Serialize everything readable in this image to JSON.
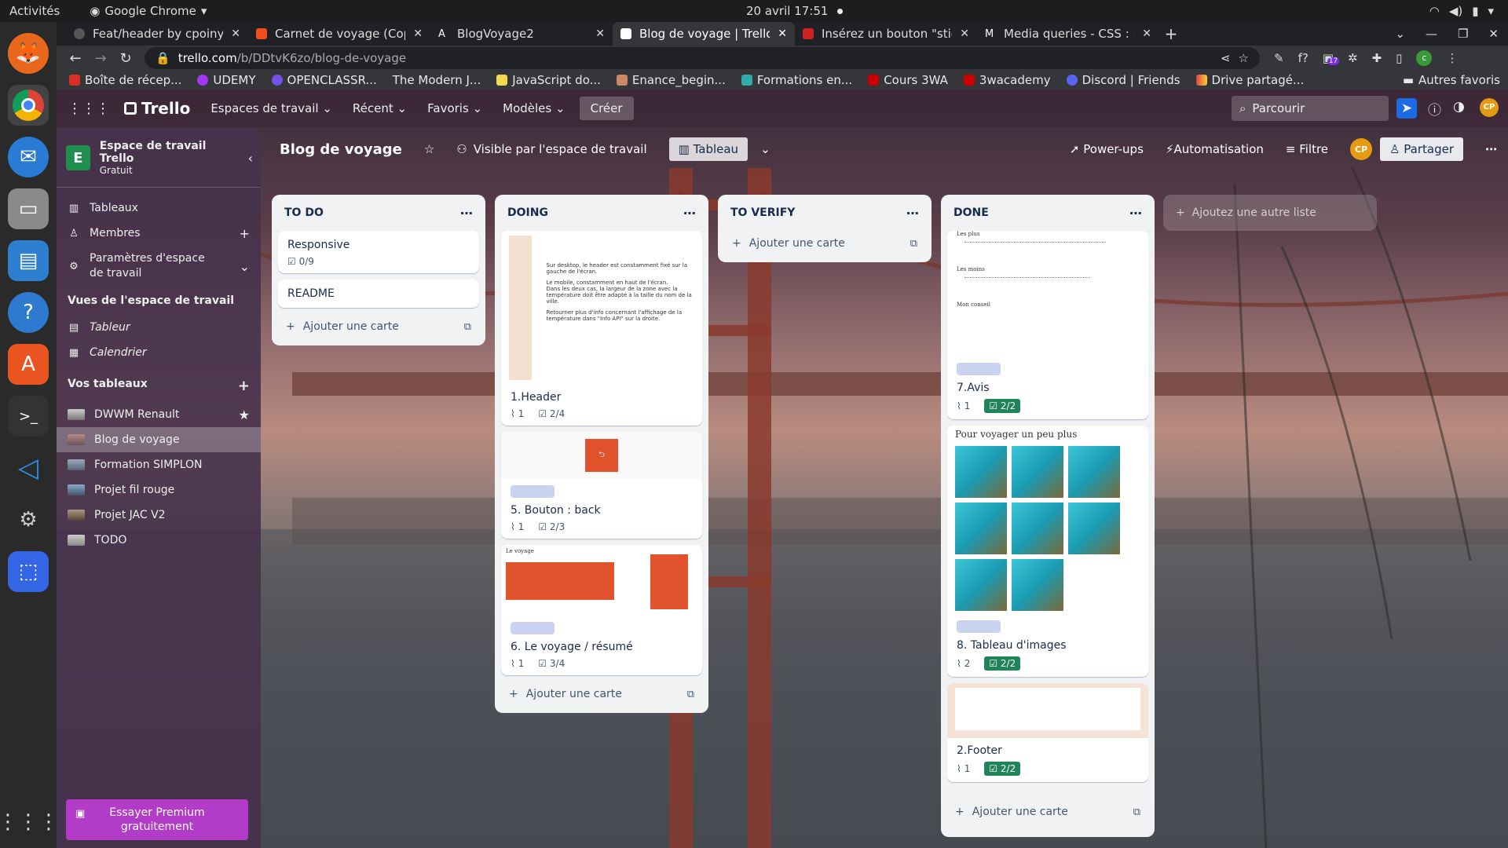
{
  "os": {
    "activities": "Activités",
    "app_name": "Google Chrome",
    "datetime": "20 avril  17:51"
  },
  "browser": {
    "tabs": [
      {
        "title": "Feat/header by cpoiny · P",
        "active": false
      },
      {
        "title": "Carnet de voyage (Copy) –",
        "active": false
      },
      {
        "title": "BlogVoyage2",
        "active": false
      },
      {
        "title": "Blog de voyage | Trello",
        "active": true
      },
      {
        "title": "Insérez un bouton \"sticky",
        "active": false
      },
      {
        "title": "Media queries - CSS : Feuil",
        "active": false
      }
    ],
    "url_host": "trello.com",
    "url_path": "/b/DDtvK6zo/blog-de-voyage",
    "bookmarks": [
      "Boîte de récep...",
      "UDEMY",
      "OPENCLASSR...",
      "The Modern J...",
      "JavaScript do...",
      "Enance_begin...",
      "Formations en...",
      "Cours 3WA",
      "3wacademy",
      "Discord | Friends",
      "Drive partagé..."
    ],
    "bookmarks_other": "Autres favoris",
    "ext_badge": "17"
  },
  "trello": {
    "logo": "Trello",
    "menu": [
      "Espaces de travail",
      "Récent",
      "Favoris",
      "Modèles"
    ],
    "create": "Créer",
    "search_placeholder": "Parcourir",
    "avatar": "CP"
  },
  "sidebar": {
    "ws_letter": "E",
    "ws_name": "Espace de travail Trello",
    "ws_plan": "Gratuit",
    "items": [
      "Tableaux",
      "Membres",
      "Paramètres d'espace de travail"
    ],
    "views_head": "Vues de l'espace de travail",
    "views": [
      "Tableur",
      "Calendrier"
    ],
    "boards_head": "Vos tableaux",
    "boards": [
      "DWWM Renault",
      "Blog de voyage",
      "Formation SIMPLON",
      "Projet fil rouge",
      "Projet JAC V2",
      "TODO"
    ],
    "premium": "Essayer Premium gratuitement"
  },
  "board": {
    "title": "Blog de voyage",
    "visibility": "Visible par l'espace de travail",
    "view": "Tableau",
    "powerups": "Power-ups",
    "automation": "Automatisation",
    "filter": "Filtre",
    "share": "Partager",
    "avatar": "CP"
  },
  "lists": {
    "todo": {
      "name": "TO DO",
      "cards": [
        {
          "title": "Responsive",
          "check": "0/9"
        },
        {
          "title": "README"
        }
      ],
      "add": "Ajouter une carte"
    },
    "doing": {
      "name": "DOING",
      "cards": [
        {
          "title": "1.Header",
          "attach": "1",
          "check": "2/4"
        },
        {
          "title": "5. Bouton : back",
          "attach": "1",
          "check": "2/3"
        },
        {
          "title": "6. Le voyage / résumé",
          "attach": "1",
          "check": "3/4"
        }
      ],
      "add": "Ajouter une carte",
      "preview_header_text": [
        "Sur desktop, le header est constamment fixé sur la gauche de l'écran.",
        "Le mobile, constamment en haut de l'écran.",
        "Dans les deux cas, la largeur de la zone avec la température doit être adapté à la taille du nom de la ville.",
        "Retourner plus d'info concernant l'affichage de la température dans \"Info API\" sur la droite."
      ],
      "preview_voyage_title": "Le voyage"
    },
    "verify": {
      "name": "TO VERIFY",
      "add": "Ajouter une carte"
    },
    "done": {
      "name": "DONE",
      "cards": [
        {
          "title": "7.Avis",
          "attach": "1",
          "check": "2/2"
        },
        {
          "title": "8. Tableau d'images",
          "attach": "2",
          "check": "2/2"
        },
        {
          "title": "2.Footer",
          "attach": "1",
          "check": "2/2"
        }
      ],
      "add": "Ajouter une carte",
      "preview_avis": [
        "Les plus",
        "Les moins",
        "Mon conseil"
      ],
      "preview_images_title": "Pour voyager un peu plus"
    },
    "add_list": "Ajoutez une autre liste"
  }
}
